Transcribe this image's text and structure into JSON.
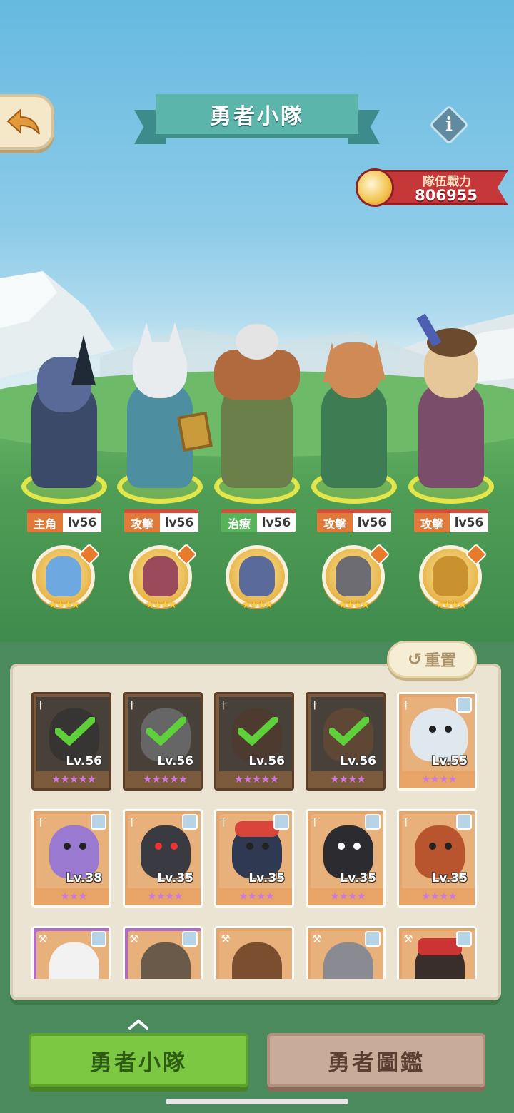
{
  "header": {
    "title": "勇者小隊",
    "back_icon": "back-arrow-icon",
    "info_label": "i"
  },
  "team_power": {
    "label": "隊伍戰力",
    "value": "806955"
  },
  "heroes": [
    {
      "role": "主角",
      "level": "lv56",
      "role_color": "#e07a3a"
    },
    {
      "role": "攻擊",
      "level": "lv56",
      "role_color": "#e07a3a"
    },
    {
      "role": "治療",
      "level": "lv56",
      "role_color": "#58b45a"
    },
    {
      "role": "攻擊",
      "level": "lv56",
      "role_color": "#e07a3a"
    },
    {
      "role": "攻擊",
      "level": "lv56",
      "role_color": "#e07a3a"
    }
  ],
  "pets": [
    {
      "stars": "★★★★"
    },
    {
      "stars": "★★★★"
    },
    {
      "stars": "★★★★"
    },
    {
      "stars": "★★★★"
    },
    {
      "stars": "★★★★"
    }
  ],
  "reset_label": "重置",
  "reset_icon": "refresh-icon",
  "roster": [
    {
      "level": "Lv.56",
      "stars": "★★★★★",
      "selected": true
    },
    {
      "level": "Lv.56",
      "stars": "★★★★★",
      "selected": true
    },
    {
      "level": "Lv.56",
      "stars": "★★★★★",
      "selected": true
    },
    {
      "level": "Lv.56",
      "stars": "★★★★",
      "selected": true
    },
    {
      "level": "Lv.55",
      "stars": "★★★★",
      "selected": false
    },
    {
      "level": "Lv.38",
      "stars": "★★★",
      "selected": false
    },
    {
      "level": "Lv.35",
      "stars": "★★★★",
      "selected": false
    },
    {
      "level": "Lv.35",
      "stars": "★★★★",
      "selected": false
    },
    {
      "level": "Lv.35",
      "stars": "★★★★",
      "selected": false
    },
    {
      "level": "Lv.35",
      "stars": "★★★★",
      "selected": false
    }
  ],
  "bottom_tabs": {
    "team": "勇者小隊",
    "codex": "勇者圖鑑"
  },
  "colors": {
    "active_tab": "#7cc843",
    "inactive_tab": "#c9ab9a",
    "power_ribbon": "#c6373a",
    "title_banner": "#5cb5ab"
  }
}
